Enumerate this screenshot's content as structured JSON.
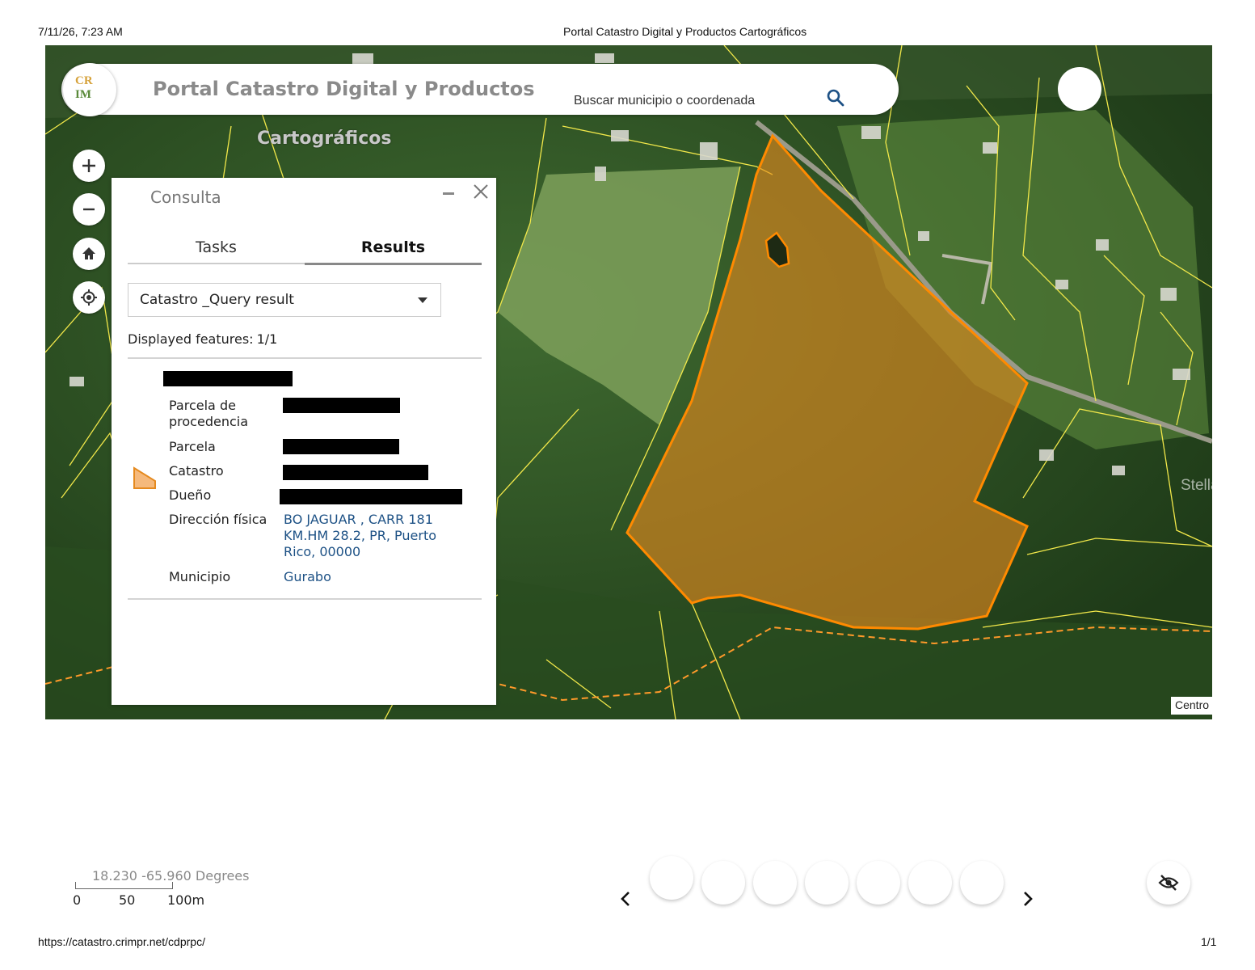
{
  "print_header": {
    "date": "7/11/26, 7:23 AM",
    "title": "Portal Catastro Digital y Productos Cartográficos"
  },
  "print_footer": {
    "url": "https://catastro.crimpr.net/cdprpc/",
    "page": "1/1"
  },
  "app": {
    "logo_text": [
      "CR",
      "IM"
    ],
    "title_line1": "Portal Catastro Digital y Productos",
    "title_line2": "Cartográficos"
  },
  "search": {
    "placeholder": "Buscar municipio o coordenada",
    "icon": "search-icon"
  },
  "map_controls": [
    {
      "name": "zoom-in-icon",
      "glyph": "+"
    },
    {
      "name": "zoom-out-icon",
      "glyph": "−"
    },
    {
      "name": "home-icon"
    },
    {
      "name": "locate-icon"
    }
  ],
  "panel": {
    "title": "Consulta",
    "tabs": [
      {
        "label": "Tasks",
        "active": false
      },
      {
        "label": "Results",
        "active": true
      }
    ],
    "selected_layer": "Catastro _Query result",
    "displayed_label": "Displayed features:",
    "displayed_value": "1/1",
    "feature": {
      "symbol_color": "#f5b97c",
      "rows": [
        {
          "label": "Parcela de procedencia",
          "value": ""
        },
        {
          "label": "Parcela",
          "value": ""
        },
        {
          "label": "Catastro",
          "value": ""
        },
        {
          "label": "Dueño",
          "value": ""
        },
        {
          "label": "Dirección física",
          "value": "BO JAGUAR , CARR 181 KM.HM 28.2, PR, Puerto Rico, 00000"
        },
        {
          "label": "Municipio",
          "value": "Gurabo"
        }
      ]
    }
  },
  "map": {
    "parcel_fill": "#e58a1f",
    "parcel_stroke": "#ff8a00",
    "parcel_line_color": "#f2e84a",
    "watermark": "StellarMLS",
    "attribution": "Centro"
  },
  "scale": {
    "coordinates": "18.230 -65.960 Degrees",
    "labels": [
      "0",
      "50",
      "100m"
    ]
  }
}
